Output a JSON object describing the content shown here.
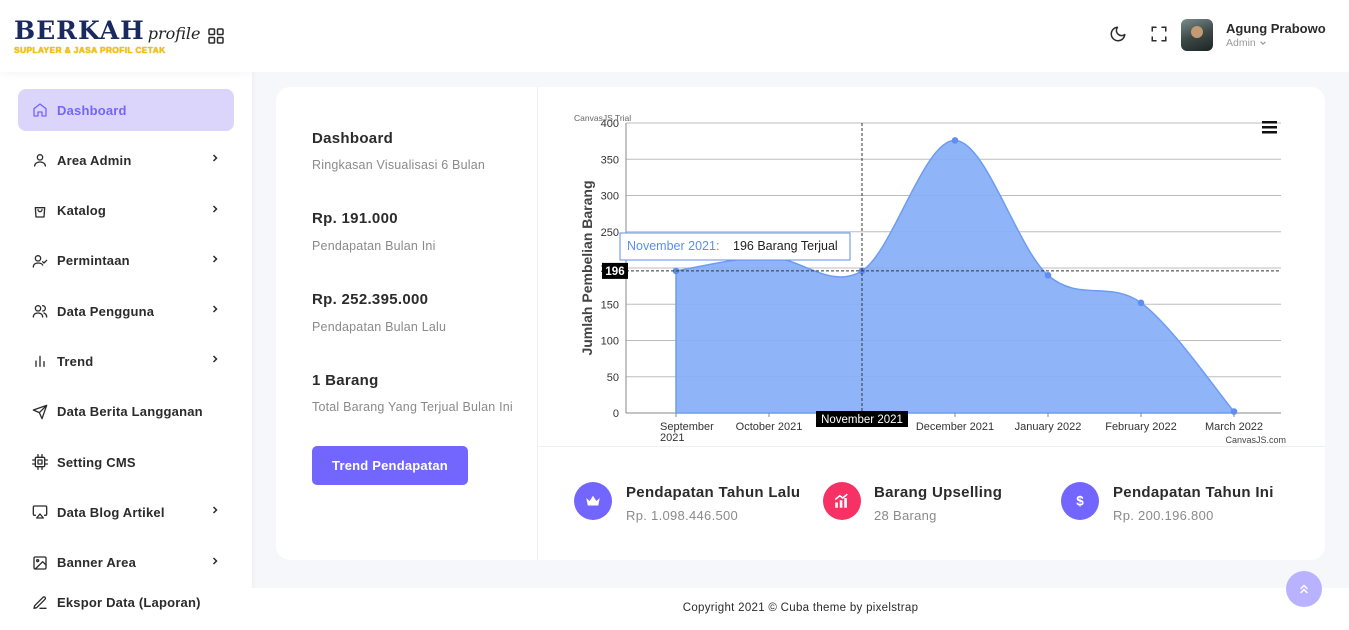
{
  "brand": {
    "name": "BERKAH",
    "script": "profile",
    "tagline": "SUPLAYER & JASA PROFIL CETAK"
  },
  "sidebar": {
    "items": [
      {
        "label": "Dashboard",
        "icon": "home-icon",
        "active": true,
        "chevron": false
      },
      {
        "label": "Area Admin",
        "icon": "user-icon",
        "active": false,
        "chevron": true
      },
      {
        "label": "Katalog",
        "icon": "shopping-bag-icon",
        "active": false,
        "chevron": true
      },
      {
        "label": "Permintaan",
        "icon": "user-check-icon",
        "active": false,
        "chevron": true
      },
      {
        "label": "Data Pengguna",
        "icon": "users-icon",
        "active": false,
        "chevron": true
      },
      {
        "label": "Trend",
        "icon": "bar-chart-icon",
        "active": false,
        "chevron": true
      },
      {
        "label": "Data Berita Langganan",
        "icon": "send-icon",
        "active": false,
        "chevron": false
      },
      {
        "label": "Setting CMS",
        "icon": "cpu-icon",
        "active": false,
        "chevron": false
      },
      {
        "label": "Data Blog Artikel",
        "icon": "airplay-icon",
        "active": false,
        "chevron": true
      },
      {
        "label": "Banner Area",
        "icon": "image-icon",
        "active": false,
        "chevron": true
      },
      {
        "label": "Ekspor Data (Laporan)",
        "icon": "edit-icon",
        "active": false,
        "chevron": false
      }
    ]
  },
  "header": {
    "user_name": "Agung Prabowo",
    "user_role": "Admin"
  },
  "summary": {
    "title": "Dashboard",
    "subtitle": "Ringkasan Visualisasi 6 Bulan",
    "stats": [
      {
        "value": "Rp. 191.000",
        "label": "Pendapatan Bulan Ini"
      },
      {
        "value": "Rp. 252.395.000",
        "label": "Pendapatan Bulan Lalu"
      },
      {
        "value": "1 Barang",
        "label": "Total Barang Yang Terjual Bulan Ini"
      }
    ],
    "button_label": "Trend Pendapatan"
  },
  "kpis": [
    {
      "title": "Pendapatan Tahun Lalu",
      "value": "Rp. 1.098.446.500",
      "icon": "crown-icon",
      "color": "#7366ff"
    },
    {
      "title": "Barang Upselling",
      "value": "28 Barang",
      "icon": "trending-up-icon",
      "color": "#f73164"
    },
    {
      "title": "Pendapatan Tahun Ini",
      "value": "Rp. 200.196.800",
      "icon": "dollar-icon",
      "color": "#7366ff"
    }
  ],
  "footer": {
    "text": "Copyright 2021 © Cuba theme by pixelstrap"
  },
  "chart_data": {
    "type": "area",
    "ylabel": "Jumlah Pembelian Barang",
    "xlabel": "",
    "categories": [
      "September 2021",
      "October 2021",
      "November 2021",
      "December 2021",
      "January 2022",
      "February 2022",
      "March 2022"
    ],
    "values": [
      196,
      215,
      196,
      376,
      190,
      152,
      2
    ],
    "ylim": [
      0,
      400
    ],
    "yticks": [
      0,
      50,
      100,
      150,
      200,
      250,
      300,
      350,
      400
    ],
    "color": "#86aef7",
    "tooltip": {
      "category": "November 2021",
      "label": "November 2021:",
      "value_text": "196 Barang Terjual",
      "crosshair_y": "196"
    },
    "watermark_top": "CanvasJS Trial",
    "credit": "CanvasJS.com"
  }
}
